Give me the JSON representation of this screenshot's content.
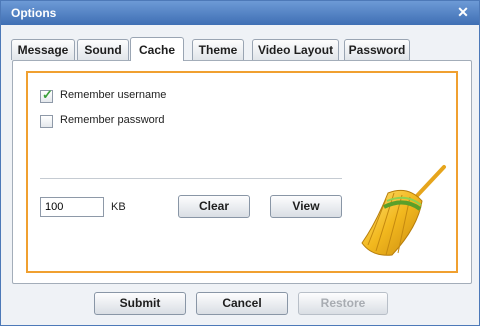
{
  "window": {
    "title": "Options"
  },
  "tabs": [
    {
      "label": "Message"
    },
    {
      "label": "Sound"
    },
    {
      "label": "Cache"
    },
    {
      "label": "Theme"
    },
    {
      "label": "Video Layout"
    },
    {
      "label": "Password"
    }
  ],
  "active_tab": "Cache",
  "cache": {
    "remember_username": {
      "label": "Remember username",
      "checked": true
    },
    "remember_password": {
      "label": "Remember password",
      "checked": false
    },
    "size_value": "100",
    "size_unit": "KB",
    "clear_label": "Clear",
    "view_label": "View",
    "illustration": "broom-icon"
  },
  "footer": {
    "submit_label": "Submit",
    "cancel_label": "Cancel",
    "restore_label": "Restore",
    "restore_enabled": false
  },
  "colors": {
    "titlebar": "#4f7fc4",
    "highlight_frame": "#f0a030",
    "check": "#3aa03a"
  }
}
